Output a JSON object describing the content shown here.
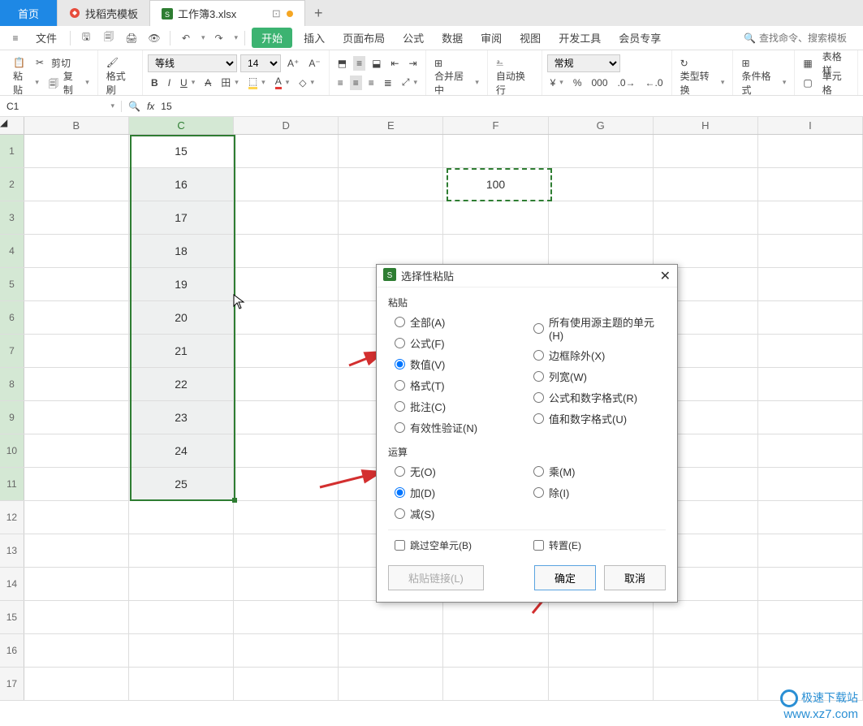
{
  "tabs": {
    "home": "首页",
    "t1": "找稻壳模板",
    "t2": "工作簿3.xlsx"
  },
  "menu": {
    "file": "文件",
    "start": "开始",
    "insert": "插入",
    "layout": "页面布局",
    "formula": "公式",
    "data": "数据",
    "review": "审阅",
    "view": "视图",
    "dev": "开发工具",
    "member": "会员专享",
    "search_ph": "查找命令、搜索模板"
  },
  "ribbon": {
    "paste": "粘贴",
    "cut": "剪切",
    "copy": "复制",
    "fmt_paint": "格式刷",
    "font": "等线",
    "size": "14",
    "merge": "合并居中",
    "wrap": "自动换行",
    "num_fmt": "常规",
    "type_conv": "类型转换",
    "cond_fmt": "条件格式",
    "cell_style": "表格样",
    "cell_style2": "单元格"
  },
  "ref": {
    "cell": "C1",
    "fx": "15"
  },
  "grid": {
    "cols": [
      "B",
      "C",
      "D",
      "E",
      "F",
      "G",
      "H",
      "I"
    ],
    "rows": [
      1,
      2,
      3,
      4,
      5,
      6,
      7,
      8,
      9,
      10,
      11,
      12,
      13,
      14,
      15,
      16,
      17
    ],
    "c_vals": [
      "15",
      "16",
      "17",
      "18",
      "19",
      "20",
      "21",
      "22",
      "23",
      "24",
      "25"
    ],
    "f2": "100"
  },
  "dialog": {
    "title": "选择性粘贴",
    "s_paste": "粘贴",
    "all": "全部(A)",
    "formula": "公式(F)",
    "value": "数值(V)",
    "format": "格式(T)",
    "comment": "批注(C)",
    "valid": "有效性验证(N)",
    "src_theme": "所有使用源主题的单元(H)",
    "border_ex": "边框除外(X)",
    "col_w": "列宽(W)",
    "fm_num": "公式和数字格式(R)",
    "val_num": "值和数字格式(U)",
    "s_op": "运算",
    "none": "无(O)",
    "add": "加(D)",
    "sub": "减(S)",
    "mul": "乘(M)",
    "div": "除(I)",
    "skip": "跳过空单元(B)",
    "trans": "转置(E)",
    "paste_link": "粘贴链接(L)",
    "ok": "确定",
    "cancel": "取消"
  },
  "watermark": {
    "l1": "极速下载站",
    "l2": "www.xz7.com"
  }
}
